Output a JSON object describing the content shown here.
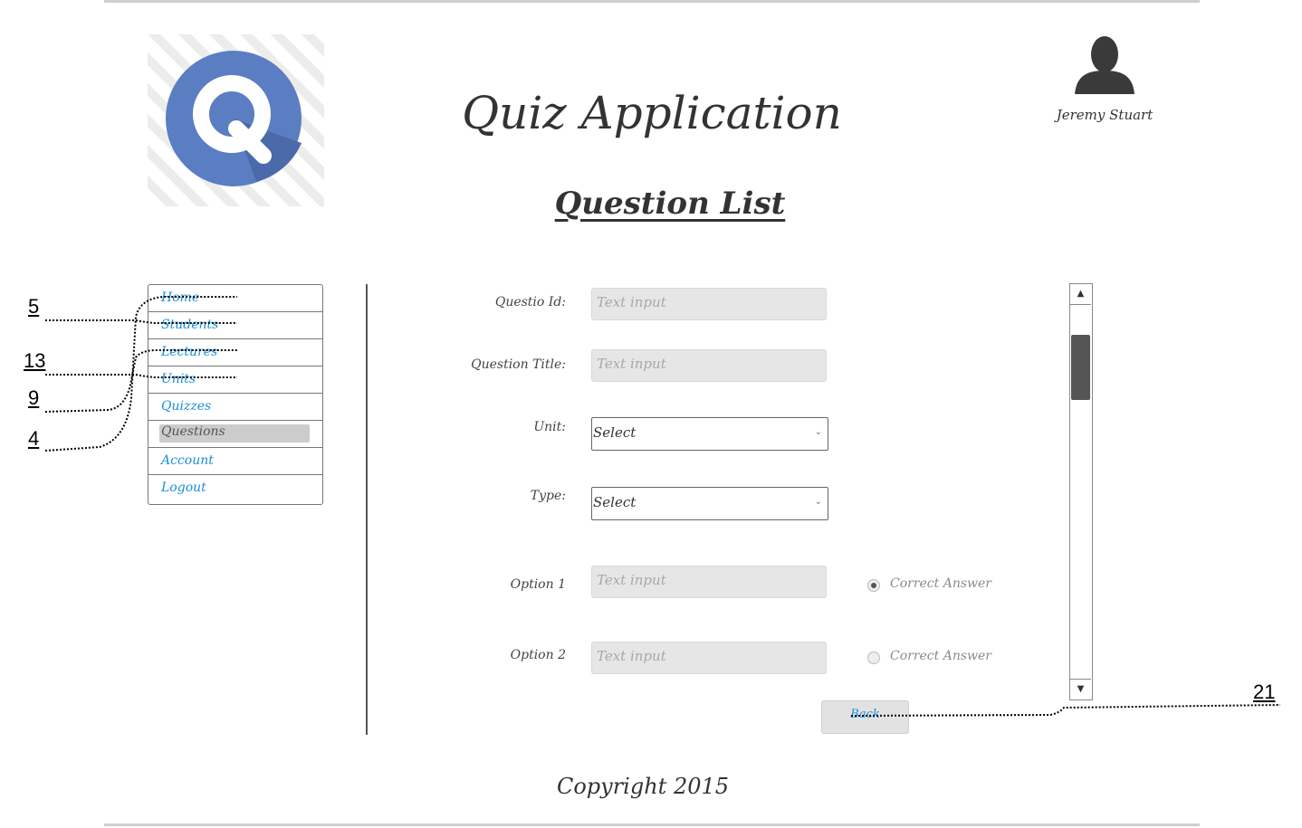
{
  "header": {
    "app_title": "Quiz Application",
    "page_title": "Question List",
    "user_name": "Jeremy Stuart",
    "logo_letter": "Q"
  },
  "colors": {
    "logo_blue": "#5b7ec2",
    "link_blue": "#1a8fd8",
    "input_gray": "#e6e6e6"
  },
  "nav": {
    "items": [
      {
        "label": "Home"
      },
      {
        "label": "Students"
      },
      {
        "label": "Lectures"
      },
      {
        "label": "Units"
      },
      {
        "label": "Quizzes"
      },
      {
        "label": "Questions",
        "active": true
      },
      {
        "label": "Account"
      },
      {
        "label": "Logout"
      }
    ]
  },
  "form": {
    "question_id": {
      "label": "Questio Id:",
      "placeholder": "Text input"
    },
    "question_title": {
      "label": "Question Title:",
      "placeholder": "Text input"
    },
    "unit": {
      "label": "Unit:",
      "value": "Select"
    },
    "type": {
      "label": "Type:",
      "value": "Select"
    },
    "option1": {
      "label": "Option 1",
      "placeholder": "Text input",
      "radio_label": "Correct Answer",
      "checked": true
    },
    "option2": {
      "label": "Option 2",
      "placeholder": "Text input",
      "radio_label": "Correct Answer",
      "checked": false
    },
    "back_label": "Back"
  },
  "footer": {
    "copyright": "Copyright 2015"
  },
  "annotations": {
    "callouts": [
      "5",
      "13",
      "9",
      "4",
      "21"
    ]
  }
}
